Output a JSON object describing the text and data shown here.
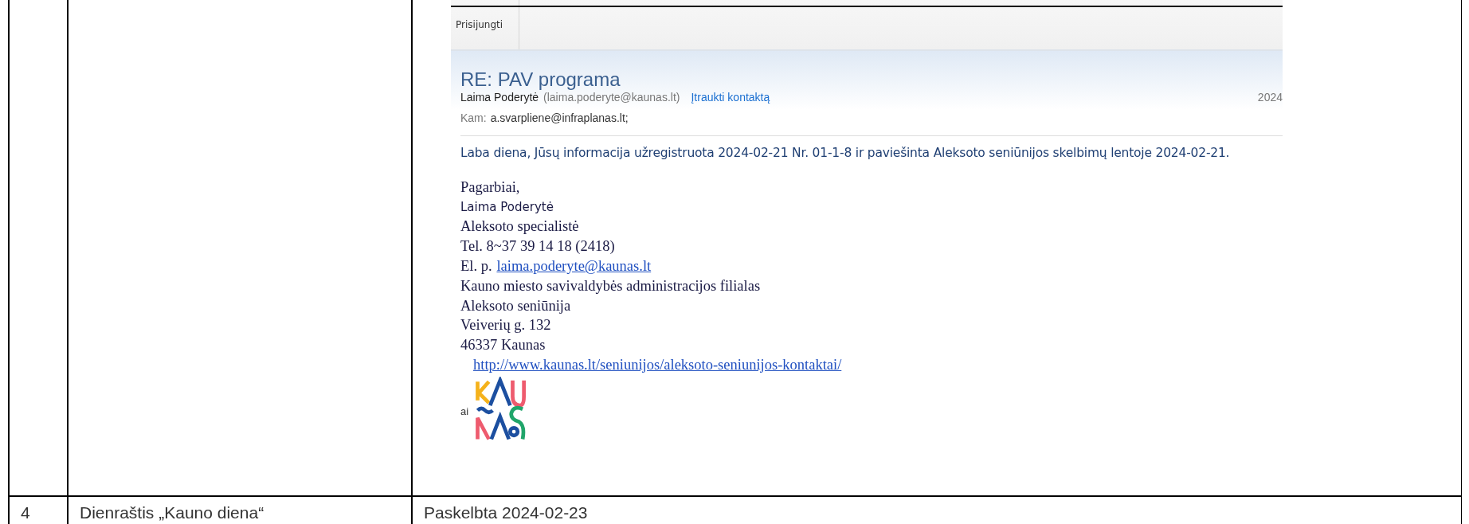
{
  "table": {
    "rows": [
      {
        "kind": "email",
        "email": {
          "ribbon_button": "Prisijungti",
          "subject": "RE: PAV programa",
          "sender_name": "Laima Poderytė",
          "sender_email": "(laima.poderyte@kaunas.lt)",
          "add_contact": "Įtraukti kontaktą",
          "date": "2024",
          "to_label": "Kam:",
          "to": "a.svarpliene@infraplanas.lt;",
          "body": "Laba diena, Jūsų informacija užregistruota 2024-02-21 Nr. 01-1-8 ir paviešinta Aleksoto seniūnijos skelbimų lentoje 2024-02-21.",
          "signature": [
            {
              "kind": "serif",
              "text": "Pagarbiai,"
            },
            {
              "kind": "sans",
              "text": "Laima Poderytė"
            },
            {
              "kind": "serif",
              "text": "Aleksoto specialistė"
            },
            {
              "kind": "serif",
              "text": "Tel. 8~37 39 14 18 (2418)"
            },
            {
              "kind": "mail",
              "text": "El. p.",
              "link": "laima.poderyte@kaunas.lt"
            },
            {
              "kind": "serif",
              "text": "Kauno miesto savivaldybės administracijos filialas"
            },
            {
              "kind": "serif",
              "text": "Aleksoto seniūnija"
            },
            {
              "kind": "serif",
              "text": "Veiverių g. 132"
            },
            {
              "kind": "serif",
              "text": "46337 Kaunas"
            },
            {
              "kind": "url",
              "link": "http://www.kaunas.lt/seniunijos/aleksoto-seniunijos-kontaktai/"
            }
          ],
          "side_text": "ai"
        }
      },
      {
        "kind": "text",
        "number": "4",
        "source": "Dienraštis „Kauno diena“",
        "result": "Paskelbta 2024-02-23"
      }
    ]
  }
}
